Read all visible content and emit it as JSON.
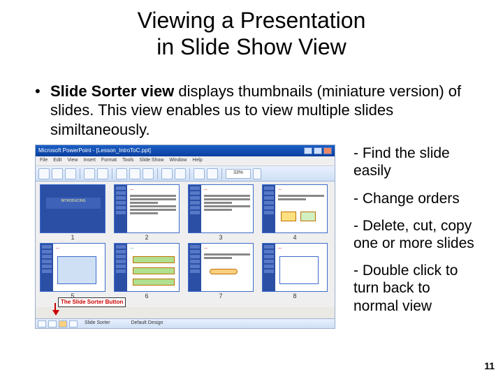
{
  "title_line1": "Viewing a Presentation",
  "title_line2": "in Slide Show View",
  "bullet_dot": "•",
  "bullet_bold": "Slide Sorter view",
  "bullet_rest": " displays thumbnails (miniature version) of slides. This view enables us to view multiple slides similtaneously.",
  "side": [
    "- Find the slide easily",
    "- Change orders",
    "- Delete, cut, copy one or more slides",
    "- Double click to turn back to normal view"
  ],
  "pagenum": "11",
  "pp": {
    "titlebar": "Microsoft PowerPoint - [Lesson_IntroToC.ppt]",
    "menu": [
      "File",
      "Edit",
      "View",
      "Insert",
      "Format",
      "Tools",
      "Slide Show",
      "Window",
      "Help"
    ],
    "zoom": "33%",
    "thumb_numbers": [
      "1",
      "2",
      "3",
      "4",
      "5",
      "6",
      "7",
      "8"
    ],
    "thumb1_text": "INTRODUCING",
    "status1": "Slide Sorter",
    "status2": "Default Design",
    "callout": "The Slide Sorter Button"
  }
}
